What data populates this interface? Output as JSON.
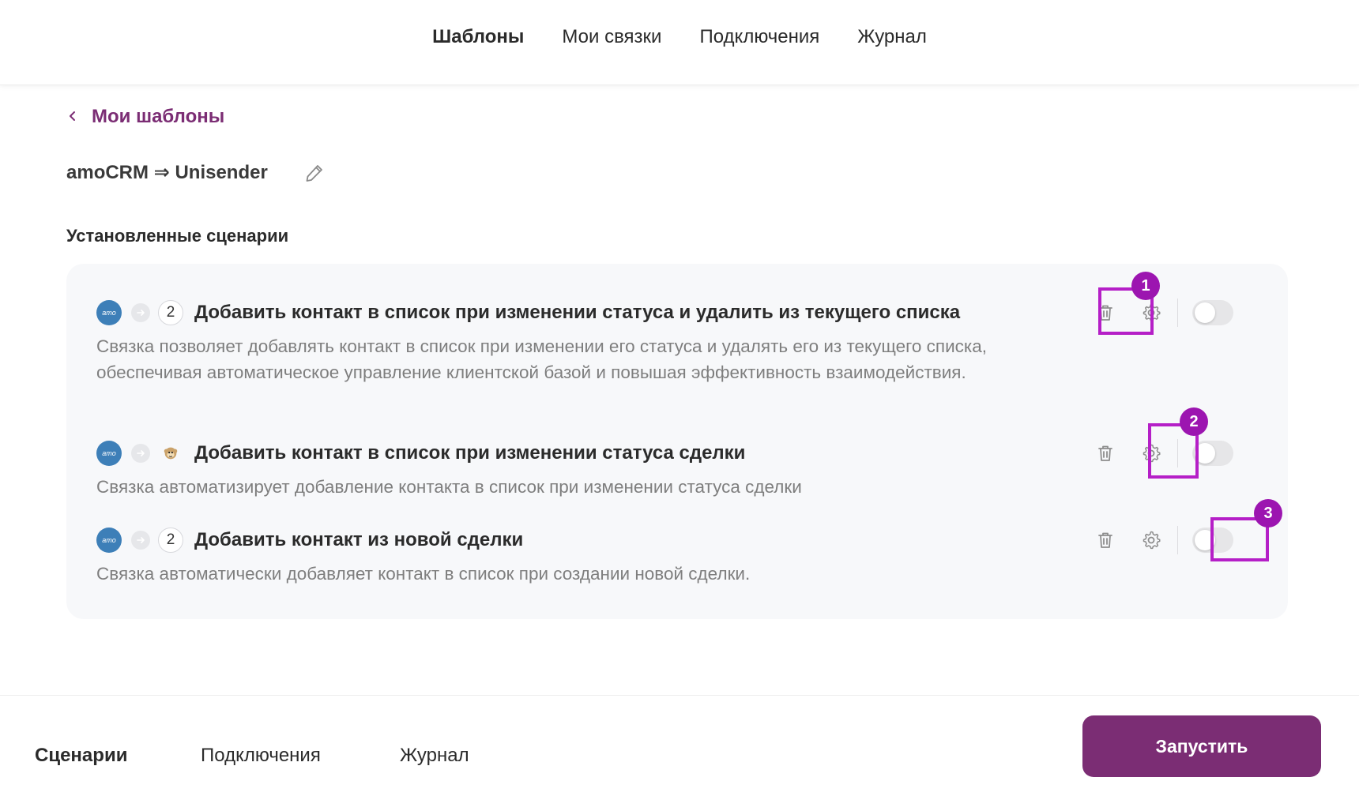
{
  "top_nav": {
    "tabs": [
      {
        "label": "Шаблоны",
        "active": true
      },
      {
        "label": "Мои связки",
        "active": false
      },
      {
        "label": "Подключения",
        "active": false
      },
      {
        "label": "Журнал",
        "active": false
      }
    ]
  },
  "back_link": {
    "label": "Мои шаблоны"
  },
  "bundle": {
    "title": "amoCRM ⇒ Unisender"
  },
  "section_title": "Установленные сценарии",
  "scenarios": [
    {
      "app_icon_text": "amo",
      "count": "2",
      "name": "Добавить контакт в список при изменении статуса и удалить из текущего списка",
      "description": "Связка позволяет добавлять контакт в список при изменении его статуса и удалять его из текущего списка, обеспечивая автоматическое управление клиентской базой и повышая эффективность взаимодействия.",
      "enabled": false
    },
    {
      "app_icon_text": "amo",
      "target_icon": "monkey-icon",
      "name": "Добавить контакт в список при изменении статуса сделки",
      "description": "Связка автоматизирует добавление контакта в список при изменении статуса сделки",
      "enabled": false
    },
    {
      "app_icon_text": "amo",
      "count": "2",
      "name": "Добавить контакт из новой сделки",
      "description": "Связка автоматически добавляет контакт в список при создании новой сделки.",
      "enabled": false
    }
  ],
  "annotations": [
    "1",
    "2",
    "3"
  ],
  "bottom_bar": {
    "tabs": [
      {
        "label": "Сценарии",
        "active": true
      },
      {
        "label": "Подключения",
        "active": false
      },
      {
        "label": "Журнал",
        "active": false
      }
    ],
    "run_button": "Запустить"
  },
  "colors": {
    "accent": "#7b2d74",
    "highlight": "#b51fc7",
    "highlight_badge": "#9c15b0",
    "amo_blue": "#3d7fb8",
    "card_bg": "#f7f8fa"
  },
  "icons": [
    "chevron-left-icon",
    "pencil-icon",
    "trash-icon",
    "gear-icon",
    "arrow-right-icon",
    "monkey-icon"
  ]
}
